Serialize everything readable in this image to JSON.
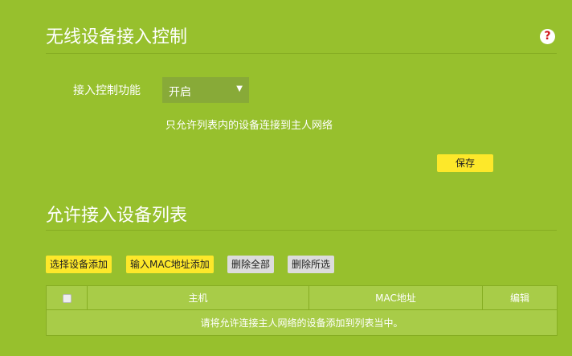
{
  "section1": {
    "title": "无线设备接入控制",
    "help_icon": "?",
    "field_label": "接入控制功能",
    "select_value": "开启",
    "note": "只允许列表内的设备连接到主人网络",
    "save": "保存"
  },
  "section2": {
    "title": "允许接入设备列表",
    "buttons": {
      "select_add": "选择设备添加",
      "mac_add": "输入MAC地址添加",
      "delete_all": "删除全部",
      "delete_selected": "删除所选"
    },
    "table": {
      "headers": [
        "主机",
        "MAC地址",
        "编辑"
      ],
      "empty": "请将允许连接主人网络的设备添加到列表当中。"
    }
  },
  "colors": {
    "background": "#97c02d",
    "button_yellow": "#fde82a"
  }
}
